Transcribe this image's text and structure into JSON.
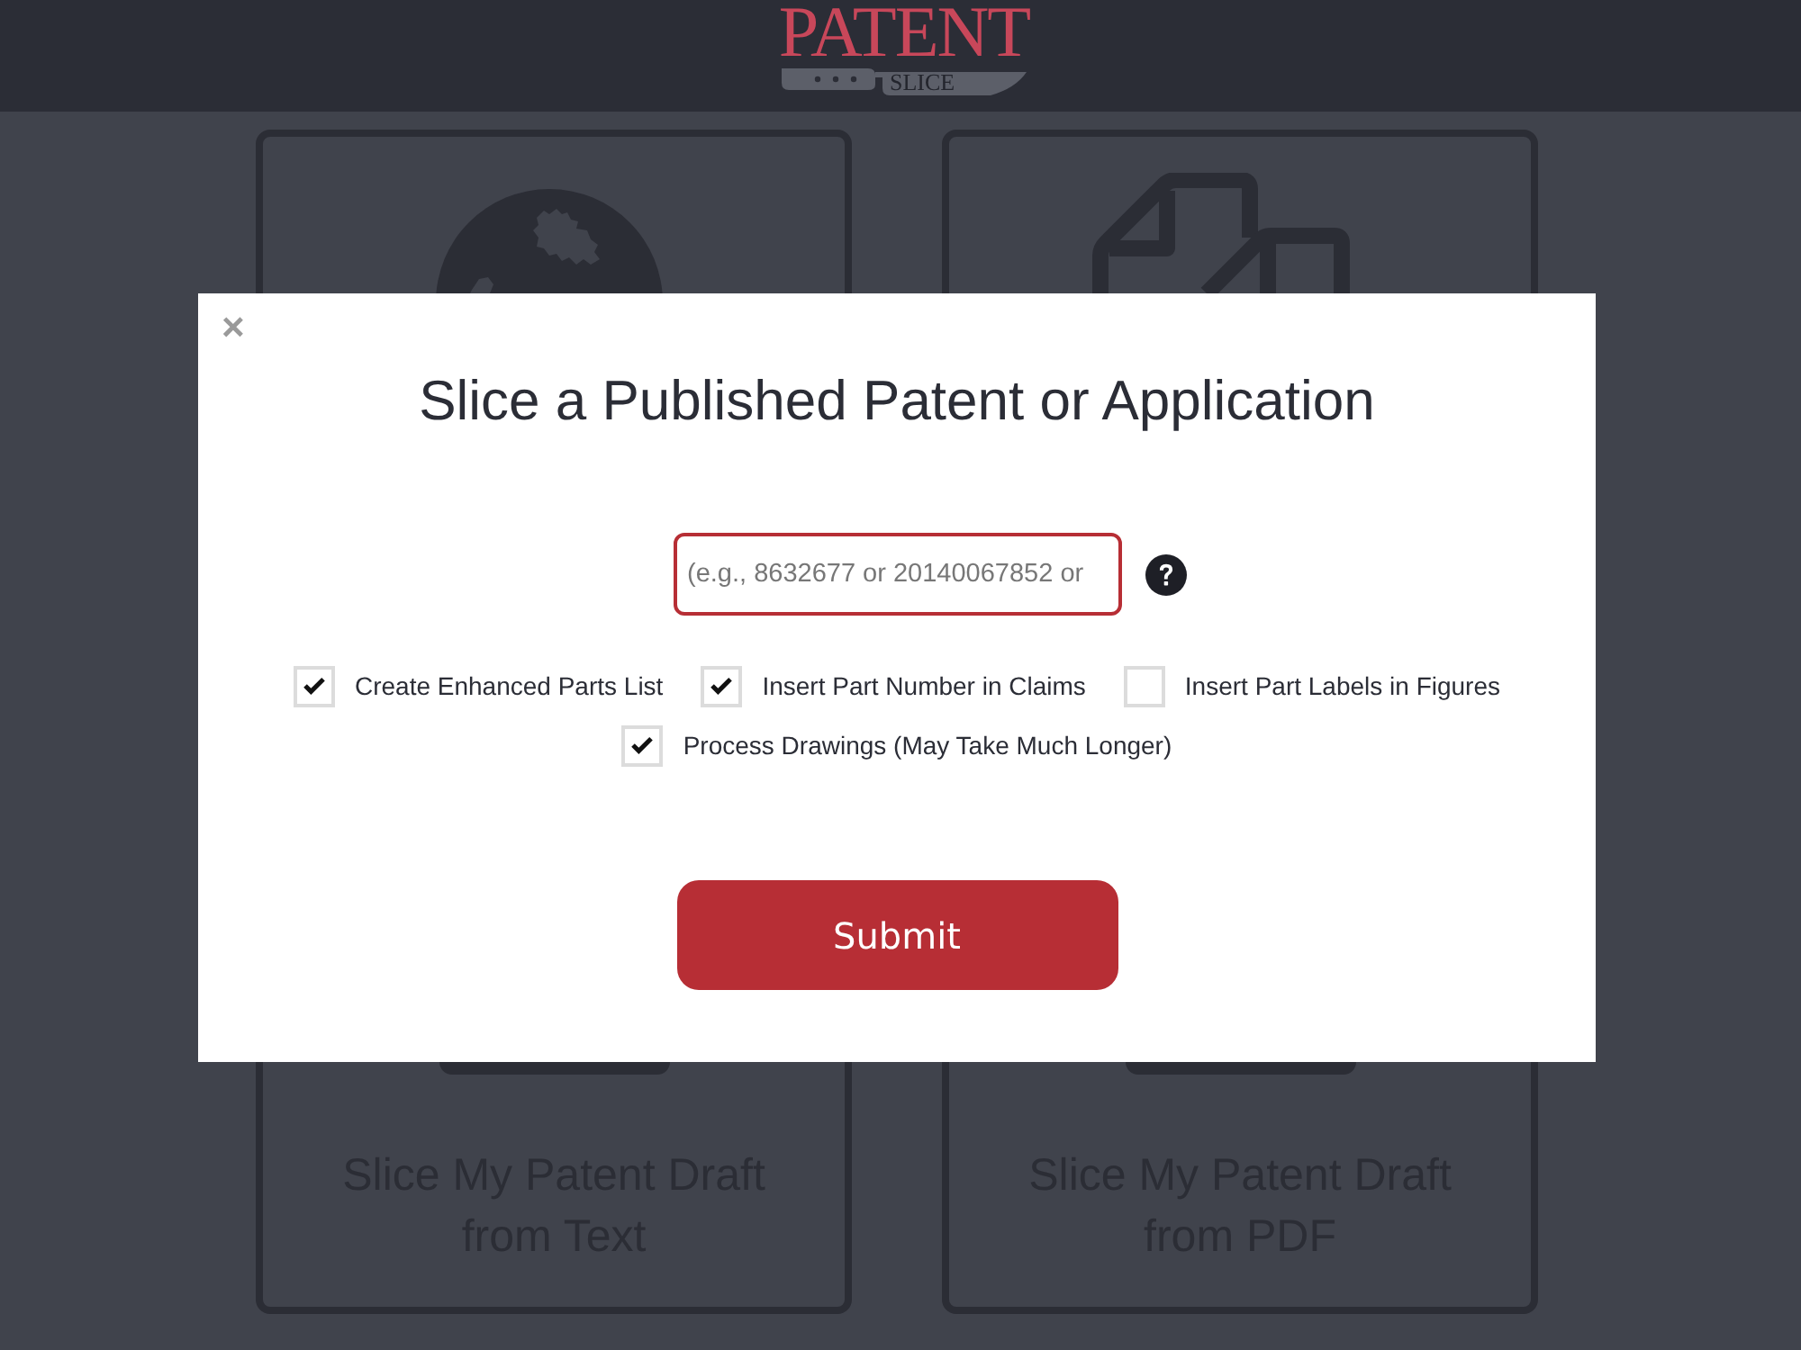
{
  "header": {
    "logo": {
      "top": "PATENT",
      "bottom": "SLICE"
    }
  },
  "cards": [
    {
      "kind": "globe",
      "title": "Slice My Patent Draft from Text"
    },
    {
      "kind": "documents",
      "title": "Slice My Patent Draft from PDF"
    }
  ],
  "dialog": {
    "close": "×",
    "title": "Slice a Published Patent or Application",
    "patent_field": {
      "placeholder": "(e.g., 8632677 or 20140067852 or"
    },
    "options": [
      {
        "label": "Create Enhanced Parts List",
        "checked": true
      },
      {
        "label": "Insert Part Number in Claims",
        "checked": true
      },
      {
        "label": "Insert Part Labels in Figures",
        "checked": false
      },
      {
        "label": "Process Drawings (May Take Much Longer)",
        "checked": true
      }
    ],
    "submit": "Submit"
  }
}
